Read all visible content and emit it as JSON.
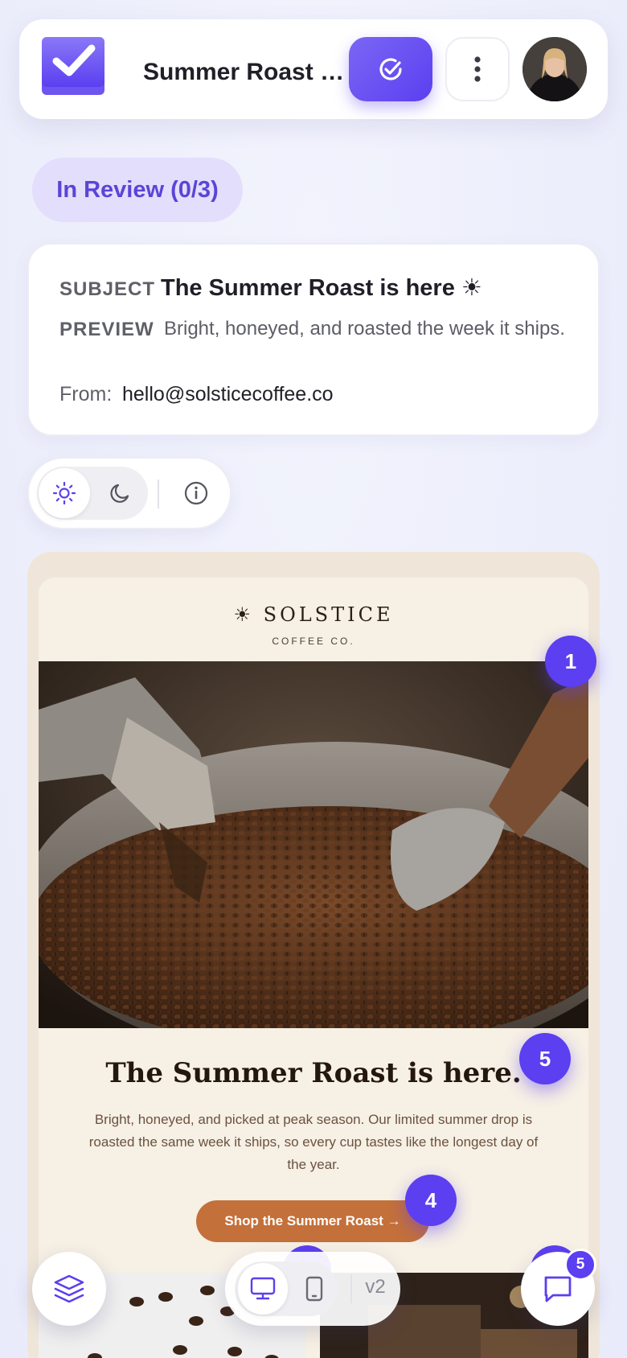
{
  "header": {
    "title": "Summer Roast – L…",
    "approve_icon": "check-circle-icon",
    "more_icon": "vertical-dots-icon"
  },
  "status": {
    "label": "In Review (0/3)"
  },
  "meta": {
    "subject_label": "SUBJECT",
    "subject_value": "The Summer Roast is here ☀",
    "preview_label": "PREVIEW",
    "preview_value": "Bright, honeyed, and roasted the week it ships.",
    "from_label": "From:",
    "from_value": "hello@solsticecoffee.co"
  },
  "theme_toggle": {
    "selected": "light"
  },
  "email": {
    "brand": "☀ SOLSTICE",
    "brand_sub": "COFFEE CO.",
    "headline": "The Summer Roast is here.",
    "paragraph": "Bright, honeyed, and picked at peak season. Our limited summer drop is roasted the same week it ships, so every cup tastes like the longest day of the year.",
    "cta": "Shop the Summer Roast →"
  },
  "pins": [
    {
      "label": "1"
    },
    {
      "label": "5"
    },
    {
      "label": "4"
    }
  ],
  "bottom_bar": {
    "selected_device": "desktop",
    "version": "v2",
    "comments_count": "5"
  },
  "colors": {
    "accent": "#5b3ff0",
    "status_bg": "#e3defc",
    "cta": "#c4703a",
    "email_bg": "#f6f0e5"
  }
}
